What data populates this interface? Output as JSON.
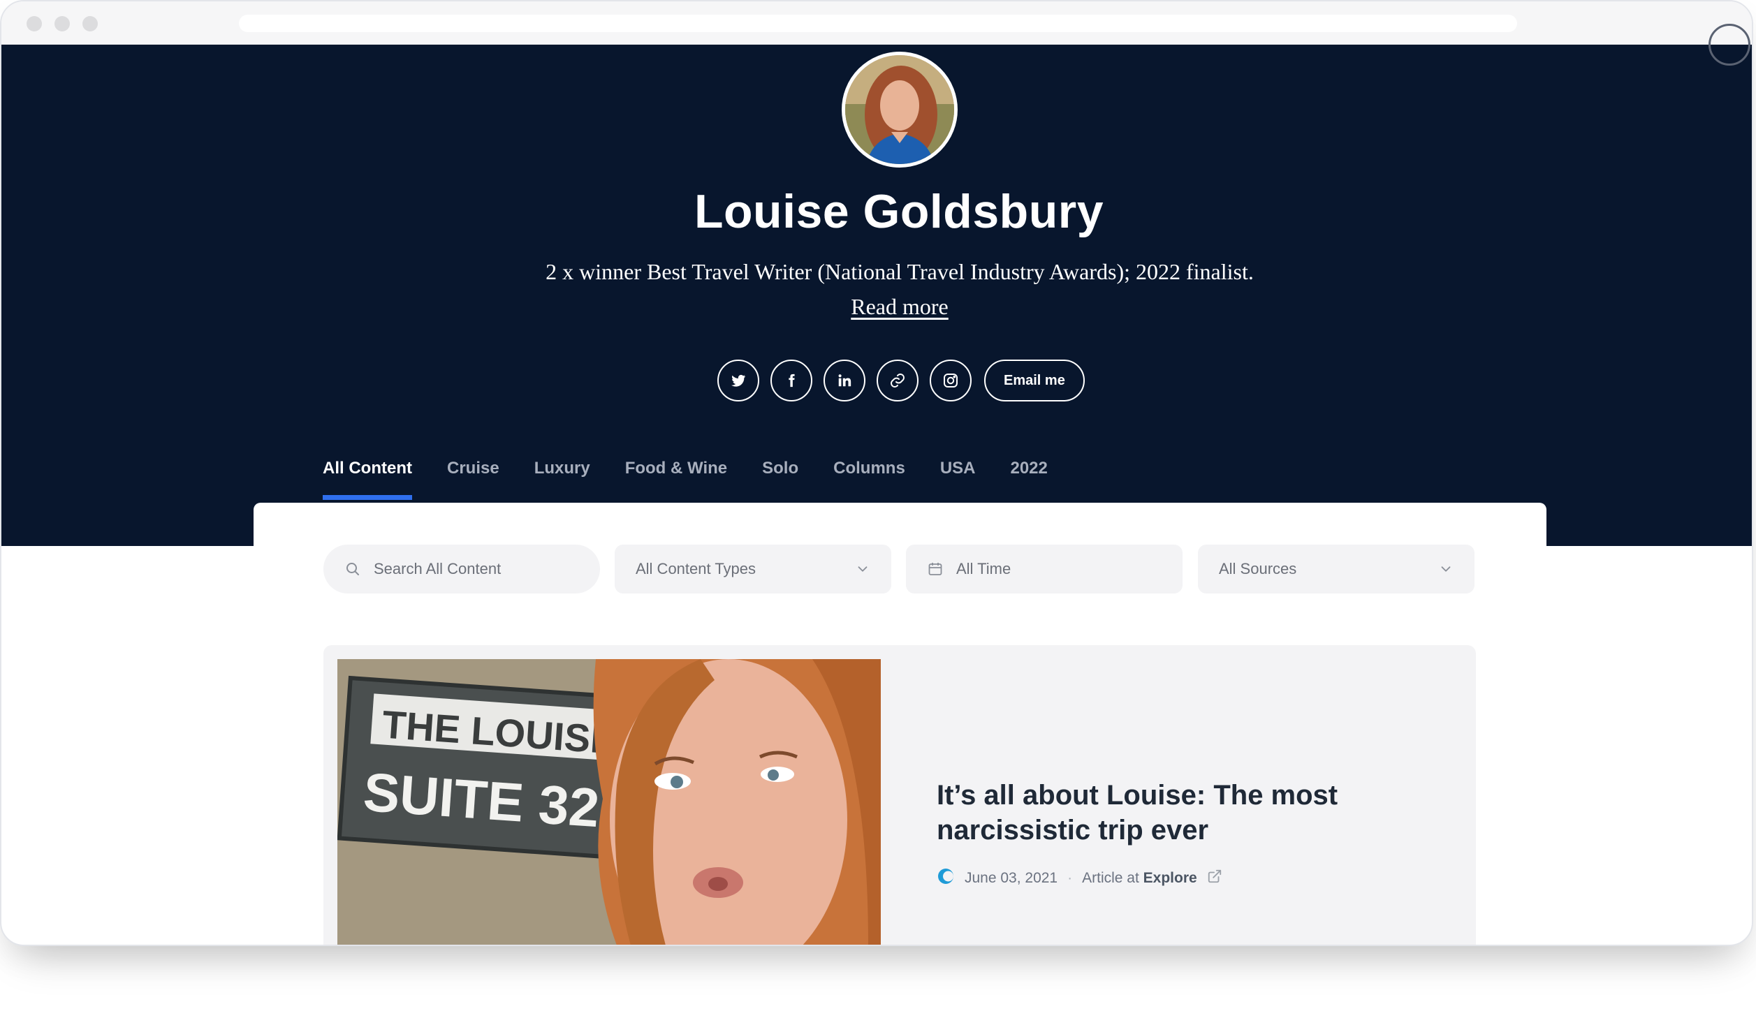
{
  "profile": {
    "name": "Louise Goldsbury",
    "bio": "2 x winner Best Travel Writer (National Travel Industry Awards); 2022 finalist.",
    "read_more": "Read more",
    "email_button": "Email me"
  },
  "socials": [
    "twitter-icon",
    "facebook-icon",
    "linkedin-icon",
    "link-icon",
    "instagram-icon"
  ],
  "tabs": [
    {
      "label": "All Content",
      "active": true
    },
    {
      "label": "Cruise"
    },
    {
      "label": "Luxury"
    },
    {
      "label": "Food & Wine"
    },
    {
      "label": "Solo"
    },
    {
      "label": "Columns"
    },
    {
      "label": "USA"
    },
    {
      "label": "2022"
    }
  ],
  "filters": {
    "search_placeholder": "Search All Content",
    "content_types": "All Content Types",
    "time": "All Time",
    "sources": "All Sources"
  },
  "article": {
    "title": "It’s all about Louise: The most narcissistic trip ever",
    "date": "June 03, 2021",
    "type_prefix": "Article at",
    "source": "Explore",
    "image_sign_line1": "THE LOUISE",
    "image_sign_line2": "SUITE 32"
  },
  "colors": {
    "hero_bg": "#08162d",
    "tab_active_underline": "#2f6fed",
    "filter_bg": "#f3f3f5"
  }
}
